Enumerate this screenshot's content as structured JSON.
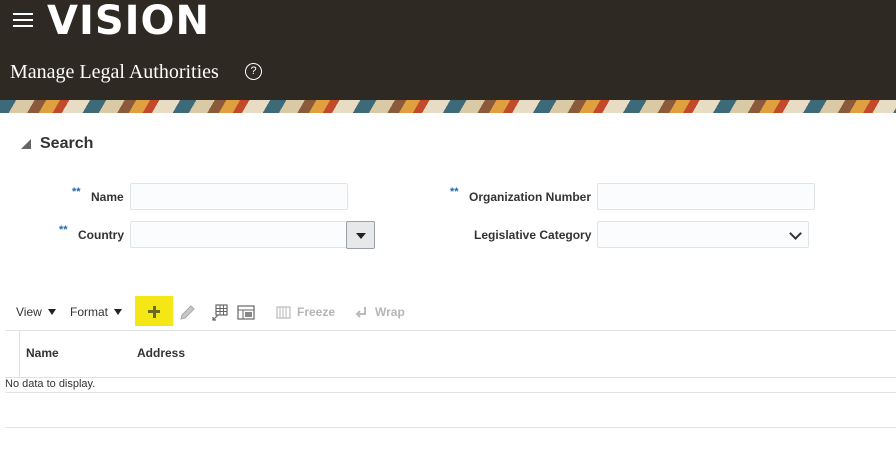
{
  "header": {
    "logo": "VISION",
    "title": "Manage Legal Authorities"
  },
  "search": {
    "section_title": "Search",
    "required_marker": "**",
    "fields": {
      "name": {
        "label": "Name",
        "value": ""
      },
      "country": {
        "label": "Country",
        "value": ""
      },
      "organization_number": {
        "label": "Organization Number",
        "value": ""
      },
      "legislative_category": {
        "label": "Legislative Category",
        "value": ""
      }
    }
  },
  "toolbar": {
    "view_label": "View",
    "format_label": "Format",
    "freeze_label": "Freeze",
    "wrap_label": "Wrap",
    "icons": [
      "add-icon",
      "edit-icon",
      "detach-icon",
      "query-by-example-icon",
      "freeze-icon",
      "wrap-icon"
    ]
  },
  "table": {
    "columns": [
      "Name",
      "Address"
    ],
    "empty_message": "No data to display."
  },
  "colors": {
    "header_bg": "#2e2923",
    "add_button_bg": "#f5e616",
    "required_marker": "#1f65b8"
  }
}
